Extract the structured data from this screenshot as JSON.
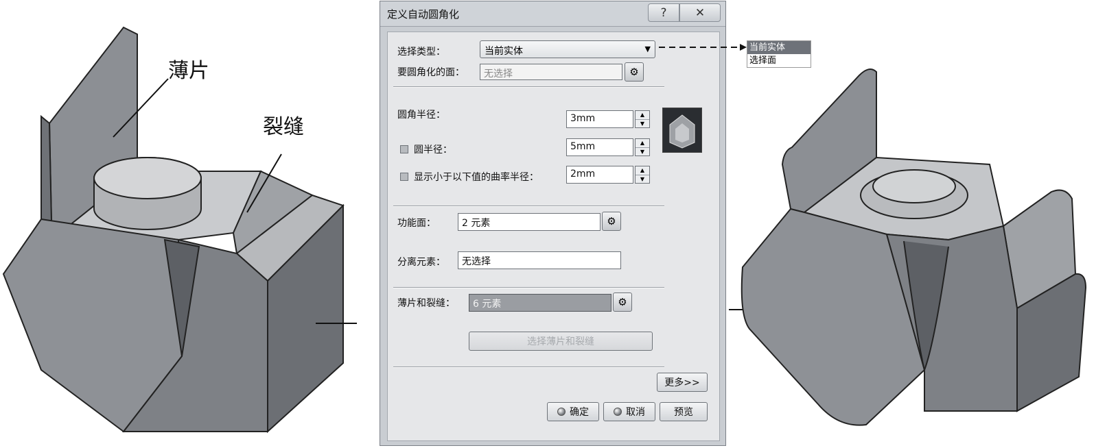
{
  "callouts": {
    "thin_wall": "薄片",
    "slot": "裂缝"
  },
  "dialog": {
    "title": "定义自动圆角化",
    "help_glyph": "?",
    "close_glyph": "✕",
    "selection_type_label": "选择类型：",
    "selection_type_value": "当前实体",
    "faces_label": "要圆角化的面：",
    "faces_value": "无选择",
    "fillet_radius_label": "圆角半径：",
    "fillet_radius_value": "3mm",
    "round_radius_label": "圆半径：",
    "round_radius_value": "5mm",
    "curvature_label": "显示小于以下值的曲率半径：",
    "curvature_value": "2mm",
    "functional_label": "功能面：",
    "functional_value": "2 元素",
    "separation_label": "分离元素：",
    "separation_value": "无选择",
    "thin_slot_label": "薄片和裂缝：",
    "thin_slot_value": "6 元素",
    "select_thin_slot_button": "选择薄片和裂缝",
    "more_button": "更多>>",
    "ok_button": "确定",
    "cancel_button": "取消",
    "preview_button": "预览"
  },
  "dropdown_options": [
    "当前实体",
    "选择面"
  ],
  "colors": {
    "dialog_bg": "#e6e7e9",
    "model_face": "#8e9196",
    "selected_item": "#6e7279"
  }
}
